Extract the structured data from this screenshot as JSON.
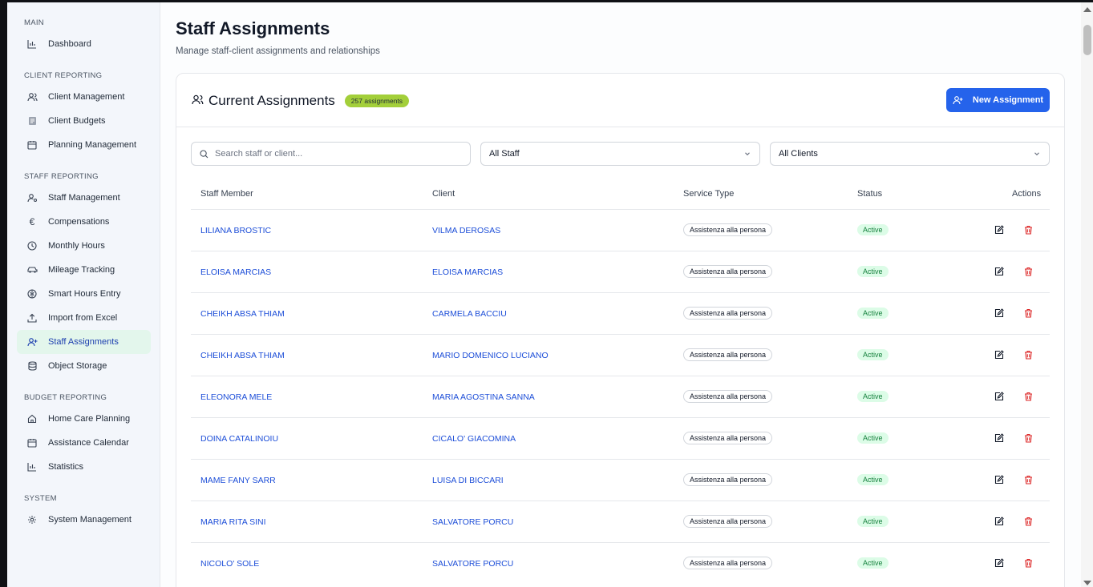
{
  "sidebar": {
    "sections": [
      {
        "title": "MAIN",
        "items": [
          {
            "label": "Dashboard",
            "icon": "bar-chart-icon"
          }
        ]
      },
      {
        "title": "CLIENT REPORTING",
        "items": [
          {
            "label": "Client Management",
            "icon": "users-icon"
          },
          {
            "label": "Client Budgets",
            "icon": "clipboard-icon"
          },
          {
            "label": "Planning Management",
            "icon": "calendar-icon"
          }
        ]
      },
      {
        "title": "STAFF REPORTING",
        "items": [
          {
            "label": "Staff Management",
            "icon": "user-cog-icon"
          },
          {
            "label": "Compensations",
            "icon": "euro-icon"
          },
          {
            "label": "Monthly Hours",
            "icon": "clock-icon"
          },
          {
            "label": "Mileage Tracking",
            "icon": "car-icon"
          },
          {
            "label": "Smart Hours Entry",
            "icon": "brain-icon"
          },
          {
            "label": "Import from Excel",
            "icon": "upload-icon"
          },
          {
            "label": "Staff Assignments",
            "icon": "user-plus-icon",
            "active": true
          },
          {
            "label": "Object Storage",
            "icon": "database-icon"
          }
        ]
      },
      {
        "title": "BUDGET REPORTING",
        "items": [
          {
            "label": "Home Care Planning",
            "icon": "home-icon"
          },
          {
            "label": "Assistance Calendar",
            "icon": "calendar-icon"
          },
          {
            "label": "Statistics",
            "icon": "bar-chart-icon"
          }
        ]
      },
      {
        "title": "SYSTEM",
        "items": [
          {
            "label": "System Management",
            "icon": "gear-icon"
          }
        ]
      }
    ]
  },
  "page": {
    "title": "Staff Assignments",
    "subtitle": "Manage staff-client assignments and relationships"
  },
  "card": {
    "title": "Current Assignments",
    "count_badge": "257 assignments",
    "new_button": "New Assignment",
    "search_placeholder": "Search staff or client...",
    "staff_filter": "All Staff",
    "client_filter": "All Clients"
  },
  "table": {
    "headers": {
      "staff": "Staff Member",
      "client": "Client",
      "service": "Service Type",
      "status": "Status",
      "actions": "Actions"
    },
    "rows": [
      {
        "staff": "LILIANA BROSTIC",
        "client": "VILMA DEROSAS",
        "service": "Assistenza alla persona",
        "status": "Active"
      },
      {
        "staff": "ELOISA MARCIAS",
        "client": "ELOISA MARCIAS",
        "service": "Assistenza alla persona",
        "status": "Active"
      },
      {
        "staff": "CHEIKH ABSA THIAM",
        "client": "CARMELA BACCIU",
        "service": "Assistenza alla persona",
        "status": "Active"
      },
      {
        "staff": "CHEIKH ABSA THIAM",
        "client": "MARIO DOMENICO LUCIANO",
        "service": "Assistenza alla persona",
        "status": "Active"
      },
      {
        "staff": "ELEONORA MELE",
        "client": "MARIA AGOSTINA SANNA",
        "service": "Assistenza alla persona",
        "status": "Active"
      },
      {
        "staff": "DOINA CATALINOIU",
        "client": "CICALO' GIACOMINA",
        "service": "Assistenza alla persona",
        "status": "Active"
      },
      {
        "staff": "MAME FANY SARR",
        "client": "LUISA DI BICCARI",
        "service": "Assistenza alla persona",
        "status": "Active"
      },
      {
        "staff": "MARIA RITA SINI",
        "client": "SALVATORE PORCU",
        "service": "Assistenza alla persona",
        "status": "Active"
      },
      {
        "staff": "NICOLO' SOLE",
        "client": "SALVATORE PORCU",
        "service": "Assistenza alla persona",
        "status": "Active"
      }
    ]
  },
  "colors": {
    "accent": "#2563eb",
    "badge": "#a3cf3a",
    "active_bg": "#dcfce7",
    "active_text": "#15803d",
    "delete": "#dc2626"
  }
}
